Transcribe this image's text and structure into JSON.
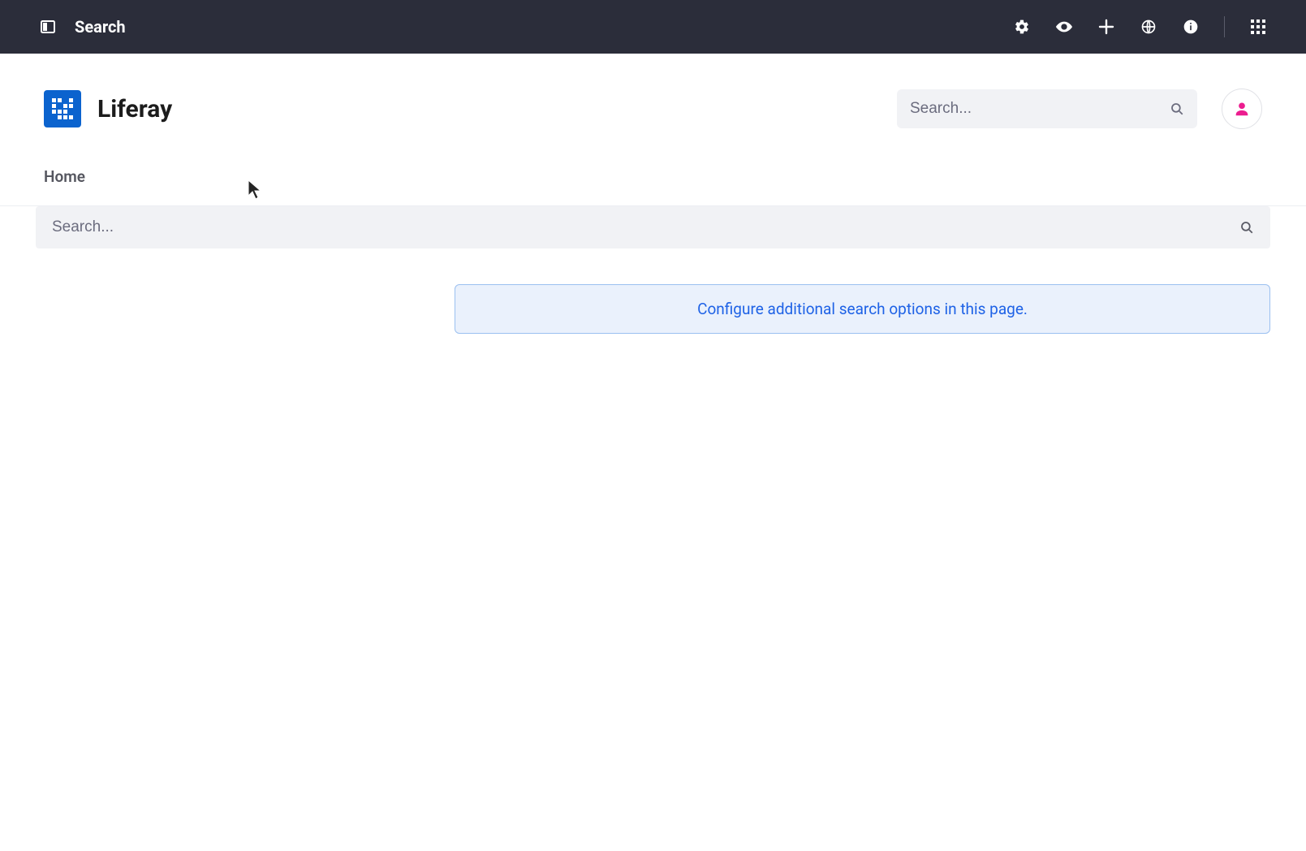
{
  "admin_bar": {
    "title": "Search",
    "icons": {
      "panel": "panel-icon",
      "gear": "gear-icon",
      "eye": "eye-icon",
      "plus": "plus-icon",
      "globe": "globe-icon",
      "info": "info-icon",
      "grid": "grid-icon"
    }
  },
  "brand": {
    "name": "Liferay"
  },
  "header_search": {
    "placeholder": "Search..."
  },
  "nav": {
    "home": "Home"
  },
  "page_search": {
    "placeholder": "Search..."
  },
  "alert": {
    "link_text": "Configure additional search options in this page."
  }
}
